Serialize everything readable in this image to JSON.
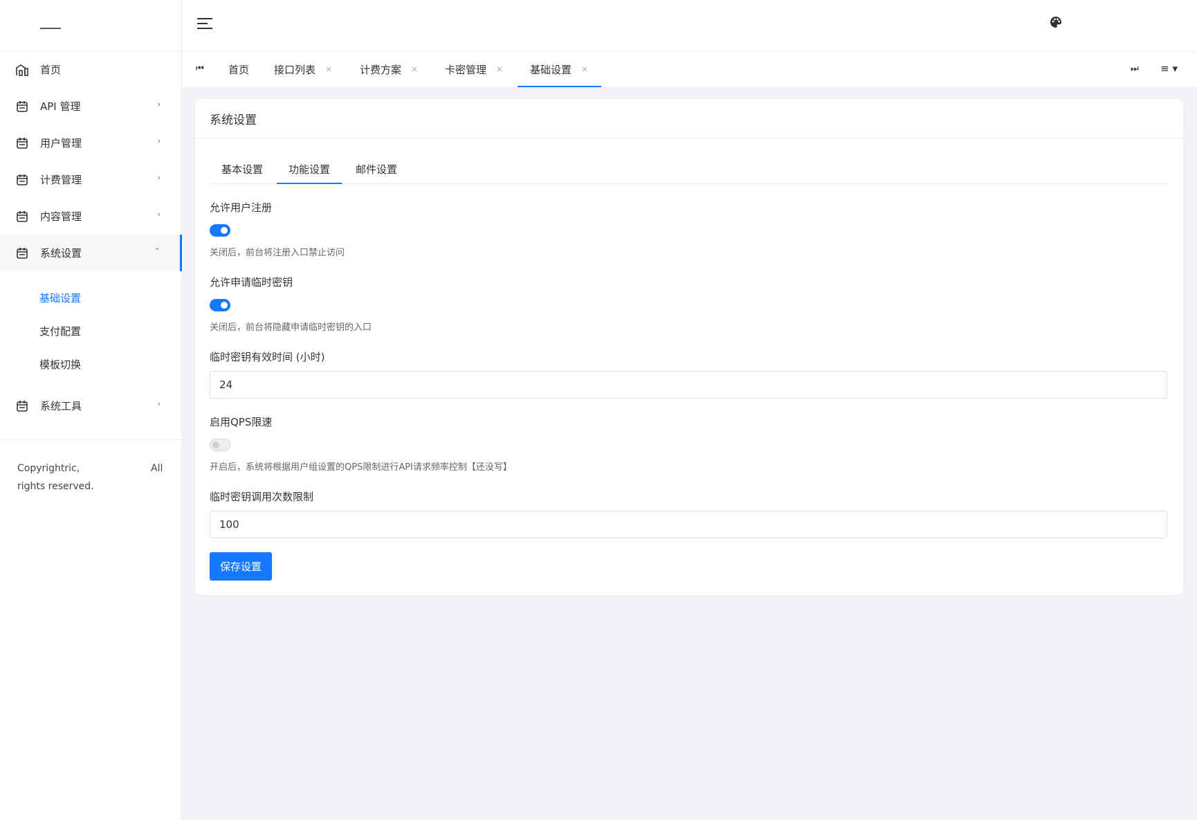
{
  "sidebar": {
    "items": [
      {
        "label": "首页",
        "icon": "dashboard-icon",
        "has_arrow": false
      },
      {
        "label": "API 管理",
        "icon": "calendar-icon",
        "arrow": "›"
      },
      {
        "label": "用户管理",
        "icon": "calendar-icon",
        "arrow": "›"
      },
      {
        "label": "计费管理",
        "icon": "calendar-icon",
        "arrow": "›"
      },
      {
        "label": "内容管理",
        "icon": "calendar-icon",
        "arrow": "›"
      },
      {
        "label": "系统设置",
        "icon": "calendar-icon",
        "arrow": "⌄"
      }
    ],
    "sub_items": [
      {
        "label": "基础设置",
        "active": true
      },
      {
        "label": "支付配置",
        "active": false
      },
      {
        "label": "模板切换",
        "active": false
      }
    ],
    "last_item": {
      "label": "系统工具",
      "icon": "calendar-icon",
      "arrow": "›"
    },
    "copyright_line1": "Copyrightric,",
    "copyright_all": "All",
    "copyright_line2": "rights reserved."
  },
  "topbar": {
    "menu_icon": "hamburger-icon",
    "theme_icon": "palette-icon"
  },
  "tabbar": {
    "prev_icon": "⏮",
    "next_icon": "⏭",
    "menu_icon": "≡ ▾",
    "close_glyph": "×",
    "tabs": [
      {
        "label": "首页",
        "closable": false
      },
      {
        "label": "接口列表",
        "closable": true
      },
      {
        "label": "计费方案",
        "closable": true
      },
      {
        "label": "卡密管理",
        "closable": true
      },
      {
        "label": "基础设置",
        "closable": true,
        "active": true
      }
    ]
  },
  "main": {
    "card_title": "系统设置",
    "inner_tabs": [
      {
        "label": "基本设置"
      },
      {
        "label": "功能设置",
        "active": true
      },
      {
        "label": "邮件设置"
      }
    ],
    "settings": {
      "register": {
        "label": "允许用户注册",
        "enabled": true,
        "hint": "关闭后，前台将注册入口禁止访问"
      },
      "temp_key": {
        "label": "允许申请临时密钥",
        "enabled": true,
        "hint": "关闭后，前台将隐藏申请临时密钥的入口"
      },
      "temp_key_hours": {
        "label": "临时密钥有效时间 (小时)",
        "value": "24"
      },
      "qps": {
        "label": "启用QPS限速",
        "enabled": false,
        "hint": "开启后，系统将根据用户组设置的QPS限制进行API请求频率控制【还没写】"
      },
      "temp_key_calls": {
        "label": "临时密钥调用次数限制",
        "value": "100"
      }
    },
    "save_label": "保存设置"
  },
  "colors": {
    "accent": "#1677ff",
    "background": "#f3f4f8"
  }
}
